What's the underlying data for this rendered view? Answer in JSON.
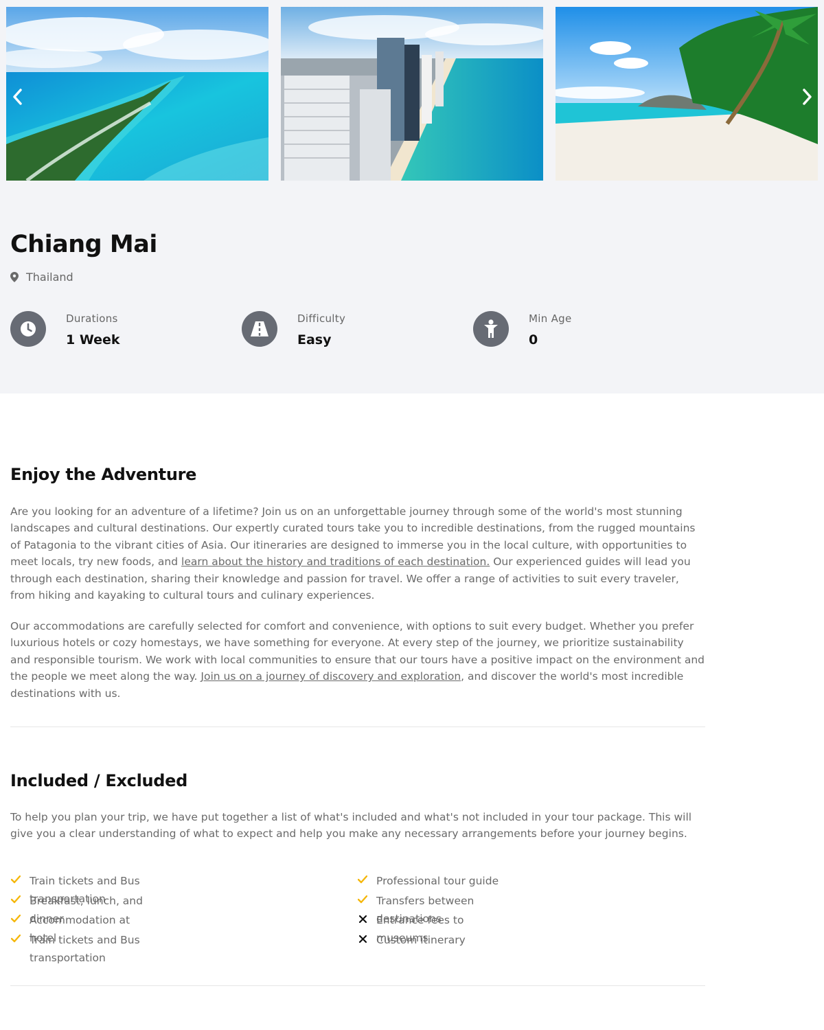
{
  "gallery": {
    "prev_icon": "chevron-left-icon",
    "next_icon": "chevron-right-icon",
    "photos": [
      "aerial-island-photo",
      "city-beach-photo",
      "tropical-beach-photo"
    ]
  },
  "tour": {
    "title": "Chiang Mai",
    "location": "Thailand",
    "location_icon": "map-pin-icon"
  },
  "facts": [
    {
      "label": "Durations",
      "value": "1 Week",
      "icon": "clock-icon"
    },
    {
      "label": "Difficulty",
      "value": "Easy",
      "icon": "road-icon"
    },
    {
      "label": "Min Age",
      "value": "0",
      "icon": "person-icon"
    }
  ],
  "adventure": {
    "heading": "Enjoy the Adventure",
    "p1_part1": "Are you looking for an adventure of a lifetime? Join us on an unforgettable journey through some of the world's most stunning landscapes and cultural destinations. Our expertly curated tours take you to incredible destinations, from the rugged mountains of Patagonia to the vibrant cities of Asia. Our itineraries are designed to immerse you in the local culture, with opportunities to meet locals, try new foods, and ",
    "p1_link": "learn about the history and traditions of each destination.",
    "p1_part2": " Our experienced guides will lead you through each destination, sharing their knowledge and passion for travel. We offer a range of activities to suit every traveler, from hiking and kayaking to cultural tours and culinary experiences.",
    "p2_part1": "Our accommodations are carefully selected for comfort and convenience, with options to suit every budget. Whether you prefer luxurious hotels or cozy homestays, we have something for everyone. At every step of the journey, we prioritize sustainability and responsible tourism. We work with local communities to ensure that our tours have a positive impact on the environment and the people we meet along the way. ",
    "p2_link": "Join us on a journey of discovery and exploration",
    "p2_part2": ", and discover the world's most incredible destinations with us."
  },
  "included_excluded": {
    "heading": "Included / Excluded",
    "intro": "To help you plan your trip, we have put together a list of what's included and what's not included in your tour package. This will give you a clear understanding of what to expect and help you make any necessary arrangements before your journey begins.",
    "left": [
      {
        "text": "Train tickets and Bus transportation",
        "included": true
      },
      {
        "text": "Breakfast, lunch, and dinner",
        "included": true
      },
      {
        "text": "Accommodation at hotel",
        "included": true
      },
      {
        "text": "Train tickets and Bus transportation",
        "included": true
      }
    ],
    "right": [
      {
        "text": "Professional tour guide",
        "included": true
      },
      {
        "text": "Transfers between destinations",
        "included": true
      },
      {
        "text": "Entrance fees to museums",
        "included": false
      },
      {
        "text": "Custom itinerary",
        "included": false
      }
    ],
    "check_color": "#f5b70b",
    "cross_color": "#111111"
  },
  "colors": {
    "header_bg": "#f3f4f7",
    "icon_circle": "#676b74",
    "body_text": "#6a6a6a"
  }
}
